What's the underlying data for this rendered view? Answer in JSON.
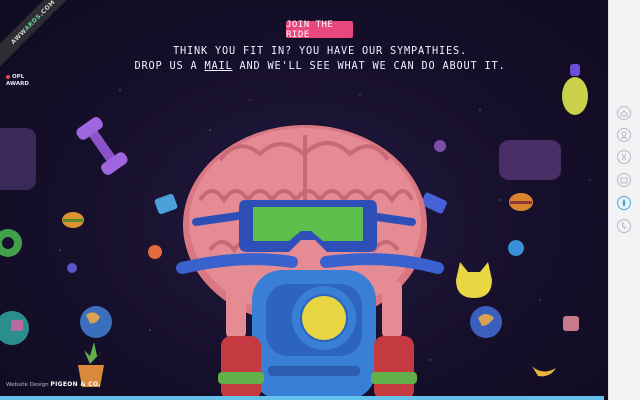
{
  "header": {
    "cta_label": "JOIN THE RIDE",
    "line1": "THINK YOU FIT IN? YOU HAVE OUR SYMPATHIES.",
    "line2_before": "DROP US A ",
    "line2_link": "MAIL",
    "line2_after": " AND WE'LL SEE WHAT WE CAN DO ABOUT IT."
  },
  "badges": {
    "ribbon_part1": "AWW",
    "ribbon_highlight": "ARDS",
    "ribbon_part2": ".COM",
    "opl_top": "OPL",
    "opl_bottom": "AWARD"
  },
  "footer": {
    "credit_prefix": "Website Design ",
    "credit_name": "PIGEON & CO."
  },
  "sidebar": {
    "items": [
      {
        "name": "nav-home-icon",
        "active": false
      },
      {
        "name": "nav-team-icon",
        "active": false
      },
      {
        "name": "nav-work-icon",
        "active": false
      },
      {
        "name": "nav-services-icon",
        "active": false
      },
      {
        "name": "nav-careers-icon",
        "active": true
      },
      {
        "name": "nav-contact-icon",
        "active": false
      }
    ]
  },
  "colors": {
    "background": "#160f2b",
    "accent_pink": "#e9477f",
    "brain": "#e3868f",
    "goggles": "#5fbf4d",
    "bike": "#3a7fd6",
    "progress": "#63c0ea"
  }
}
